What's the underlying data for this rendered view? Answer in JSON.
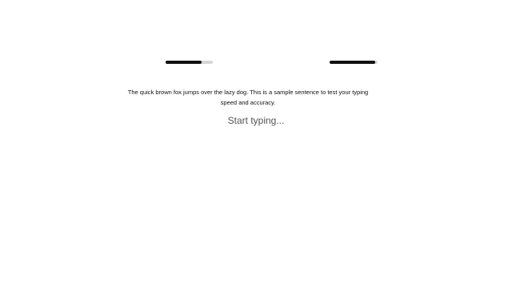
{
  "typing_test": {
    "sample_text": "The quick brown fox jumps over the lazy dog. This is a sample sentence to test your typing speed and accuracy.",
    "input_placeholder": "Start typing..."
  },
  "progress": {
    "left_fraction": 0.76,
    "right_fraction": 0.95
  },
  "colors": {
    "progress_fill": "#111111",
    "progress_track": "#d6d6d6",
    "text": "#111111",
    "placeholder": "#555555",
    "background": "#ffffff"
  }
}
